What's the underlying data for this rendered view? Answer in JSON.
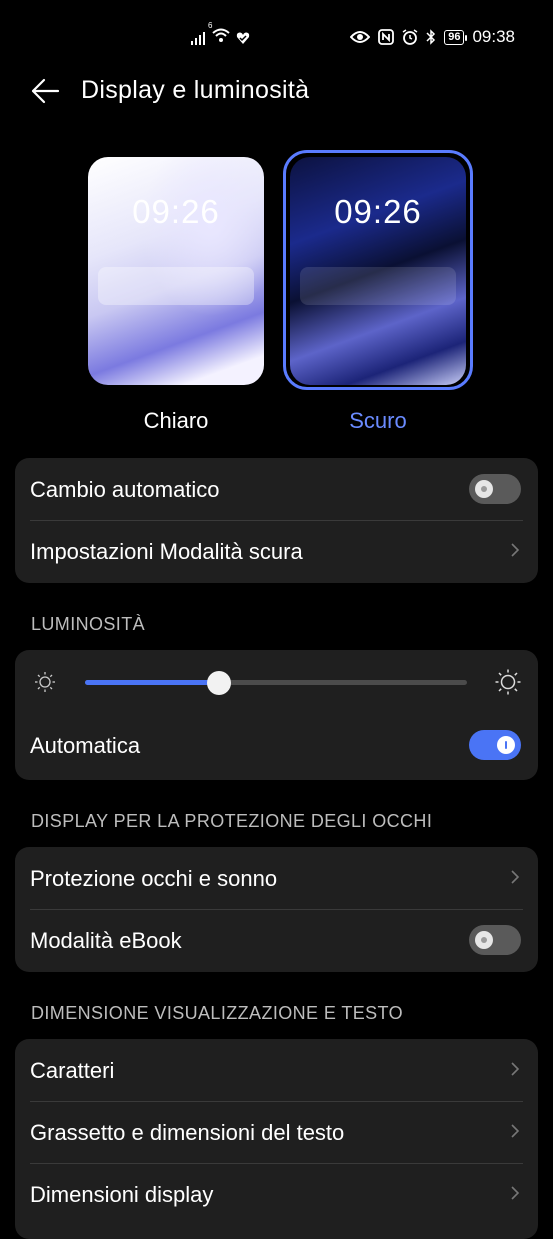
{
  "status_bar": {
    "signal_icon": "signal-icon",
    "wifi_icon": "wifi-icon",
    "wifi_badge": "6",
    "health_icon": "heart-shield-icon",
    "eye_icon": "eye-icon",
    "nfc_icon": "nfc-icon",
    "alarm_icon": "alarm-icon",
    "bluetooth_icon": "bluetooth-icon",
    "battery": "96",
    "time": "09:38"
  },
  "header": {
    "title": "Display e luminosità"
  },
  "themes": {
    "light": {
      "time": "09:26",
      "label": "Chiaro",
      "selected": false
    },
    "dark": {
      "time": "09:26",
      "label": "Scuro",
      "selected": true,
      "accent": "#6a8bff"
    }
  },
  "theme_card": {
    "auto_switch": {
      "label": "Cambio automatico",
      "on": false
    },
    "dark_settings": {
      "label": "Impostazioni Modalità scura"
    }
  },
  "brightness": {
    "section_title": "LUMINOSITÀ",
    "level": 0.35,
    "automatic": {
      "label": "Automatica",
      "on": true
    }
  },
  "eye_protection": {
    "section_title": "DISPLAY PER LA PROTEZIONE DEGLI OCCHI",
    "eye_sleep": {
      "label": "Protezione occhi e sonno"
    },
    "ebook": {
      "label": "Modalità eBook",
      "on": false
    }
  },
  "display_size": {
    "section_title": "DIMENSIONE VISUALIZZAZIONE E TESTO",
    "fonts": {
      "label": "Caratteri"
    },
    "bold_size": {
      "label": "Grassetto e dimensioni del testo"
    },
    "display_dims": {
      "label": "Dimensioni display"
    }
  },
  "colors": {
    "accent": "#4a74f5",
    "card": "#1f1f1f",
    "background": "#000000"
  }
}
